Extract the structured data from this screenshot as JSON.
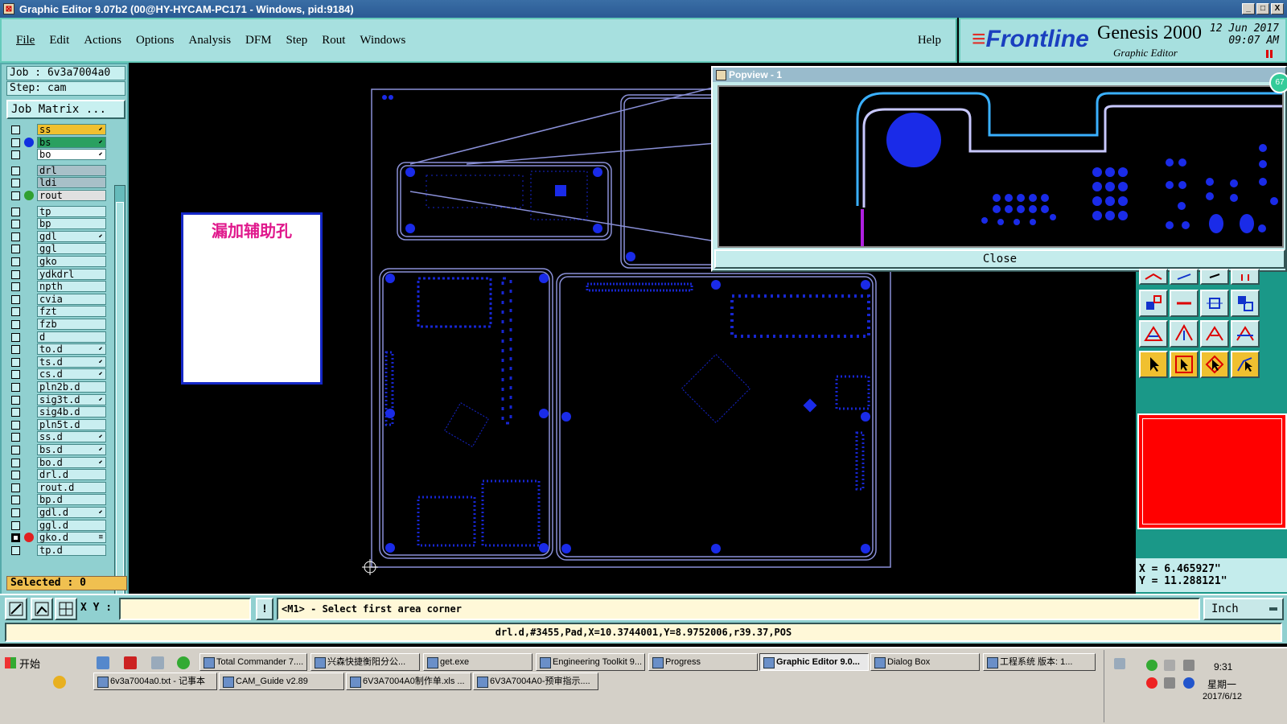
{
  "window": {
    "title": "Graphic Editor 9.07b2 (00@HY-HYCAM-PC171 - Windows, pid:9184)",
    "controls": [
      "_",
      "□",
      "X"
    ]
  },
  "menu": {
    "items": [
      "File",
      "Edit",
      "Actions",
      "Options",
      "Analysis",
      "DFM",
      "Step",
      "Rout",
      "Windows"
    ],
    "help": "Help"
  },
  "brand": {
    "logo": "Frontline",
    "product": "Genesis 2000",
    "subtitle": "Graphic Editor",
    "date": "12 Jun 2017",
    "time": "09:07 AM"
  },
  "job": {
    "job_label": "Job : 6v3a7004a0",
    "step_label": "Step: cam",
    "matrix_button": "Job Matrix ..."
  },
  "layers": [
    {
      "name": "ss",
      "color": "#f0c030",
      "marker": "⬋"
    },
    {
      "name": "bs",
      "color": "#2aa060",
      "marker": "⬋",
      "dot": "#1030e0"
    },
    {
      "name": "bo",
      "color": "#ffffff",
      "marker": "⬋"
    },
    {
      "name": "drl",
      "color": "#a8c0c8",
      "gap": true
    },
    {
      "name": "ldi",
      "color": "#a8c0c8"
    },
    {
      "name": "rout",
      "color": "#e0e0e0",
      "dot": "#30a030"
    },
    {
      "name": "tp",
      "color": "#c9eef0",
      "gap": true
    },
    {
      "name": "bp",
      "color": "#c9eef0"
    },
    {
      "name": "gdl",
      "color": "#c9eef0",
      "marker": "⬋"
    },
    {
      "name": "ggl",
      "color": "#c9eef0"
    },
    {
      "name": "gko",
      "color": "#c9eef0"
    },
    {
      "name": "ydkdrl",
      "color": "#c9eef0"
    },
    {
      "name": "npth",
      "color": "#c9eef0"
    },
    {
      "name": "cvia",
      "color": "#c9eef0"
    },
    {
      "name": "fzt",
      "color": "#c9eef0"
    },
    {
      "name": "fzb",
      "color": "#c9eef0"
    },
    {
      "name": "d",
      "color": "#c9eef0"
    },
    {
      "name": "to.d",
      "color": "#c9eef0",
      "marker": "⬋"
    },
    {
      "name": "ts.d",
      "color": "#c9eef0",
      "marker": "⬋"
    },
    {
      "name": "cs.d",
      "color": "#c9eef0",
      "marker": "⬋"
    },
    {
      "name": "pln2b.d",
      "color": "#c9eef0"
    },
    {
      "name": "sig3t.d",
      "color": "#c9eef0",
      "marker": "⬋"
    },
    {
      "name": "sig4b.d",
      "color": "#c9eef0"
    },
    {
      "name": "pln5t.d",
      "color": "#c9eef0"
    },
    {
      "name": "ss.d",
      "color": "#c9eef0",
      "marker": "⬋"
    },
    {
      "name": "bs.d",
      "color": "#c9eef0",
      "marker": "⬋"
    },
    {
      "name": "bo.d",
      "color": "#c9eef0",
      "marker": "⬋"
    },
    {
      "name": "drl.d",
      "color": "#c9eef0"
    },
    {
      "name": "rout.d",
      "color": "#c9eef0"
    },
    {
      "name": "bp.d",
      "color": "#c9eef0"
    },
    {
      "name": "gdl.d",
      "color": "#c9eef0",
      "marker": "⬋"
    },
    {
      "name": "ggl.d",
      "color": "#c9eef0"
    },
    {
      "name": "gko.d",
      "color": "#c9eef0",
      "dot": "#e02020",
      "checked": true,
      "marker": "≡"
    },
    {
      "name": "tp.d",
      "color": "#c9eef0"
    }
  ],
  "selected": "Selected : 0",
  "note": "漏加辅助孔",
  "popview": {
    "title": "Popview - 1",
    "close": "Close",
    "badge": "67"
  },
  "coords": {
    "x": "X = 6.465927\"",
    "y": "Y = 11.288121\""
  },
  "bottom": {
    "xy_label": "X Y :",
    "xy_value": "",
    "bang": "!",
    "prompt": "<M1> - Select first area corner",
    "unit": "Inch",
    "status": "drl.d,#3455,Pad,X=10.3744001,Y=8.9752006,r39.37,POS"
  },
  "taskbar": {
    "start": "开始",
    "row1": [
      "Total Commander 7....",
      "兴森快捷衡阳分公...",
      "get.exe",
      "Engineering Toolkit 9...",
      "Progress",
      "Graphic Editor 9.0...",
      "Dialog Box",
      "工程系统 版本: 1..."
    ],
    "row2": [
      "6v3a7004a0.txt - 记事本",
      "CAM_Guide v2.89",
      "6V3A7004A0制作单.xls ...",
      "6V3A7004A0-预审指示...."
    ],
    "time": "9:31",
    "weekday": "星期一",
    "date": "2017/6/12"
  },
  "colors": {
    "canvas": "#000000",
    "copper": "#1a2be8",
    "outline": "#8a90d8",
    "panel": "#90d0d0"
  }
}
